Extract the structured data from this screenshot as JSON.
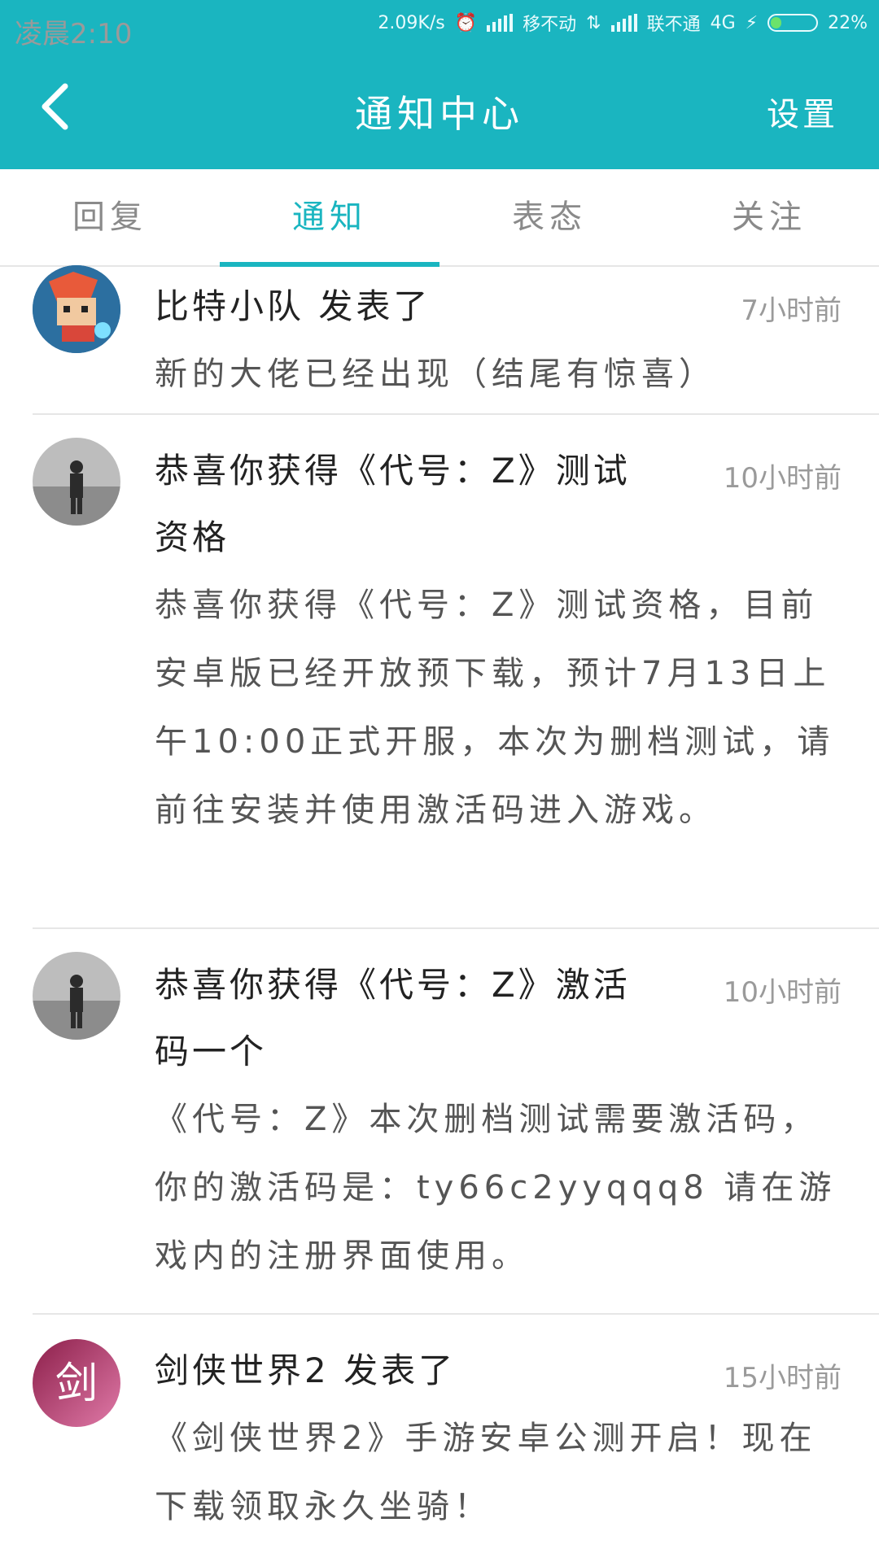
{
  "status_bar": {
    "time": "凌晨2:10",
    "speed": "2.09K/s",
    "carrier1": "移不动",
    "carrier2": "联不通",
    "network": "4G",
    "battery": "22%",
    "battery_level": 0.22
  },
  "header": {
    "title": "通知中心",
    "settings": "设置"
  },
  "tabs": [
    {
      "label": "回复",
      "active": false
    },
    {
      "label": "通知",
      "active": true
    },
    {
      "label": "表态",
      "active": false
    },
    {
      "label": "关注",
      "active": false
    }
  ],
  "notifications": [
    {
      "title": "比特小队 发表了",
      "time": "7小时前",
      "body": "新的大佬已经出现（结尾有惊喜）"
    },
    {
      "title": "恭喜你获得《代号：Z》测试资格",
      "time": "10小时前",
      "body": "恭喜你获得《代号：Z》测试资格，目前安卓版已经开放预下载，预计7月13日上午10:00正式开服，本次为删档测试，请前往安装并使用激活码进入游戏。"
    },
    {
      "title": "恭喜你获得《代号：Z》激活码一个",
      "time": "10小时前",
      "body": "《代号：Z》本次删档测试需要激活码，你的激活码是：ty66c2yyqqq8 请在游戏内的注册界面使用。"
    },
    {
      "title": "剑侠世界2 发表了",
      "time": "15小时前",
      "body": "《剑侠世界2》手游安卓公测开启！现在下载领取永久坐骑！"
    }
  ]
}
